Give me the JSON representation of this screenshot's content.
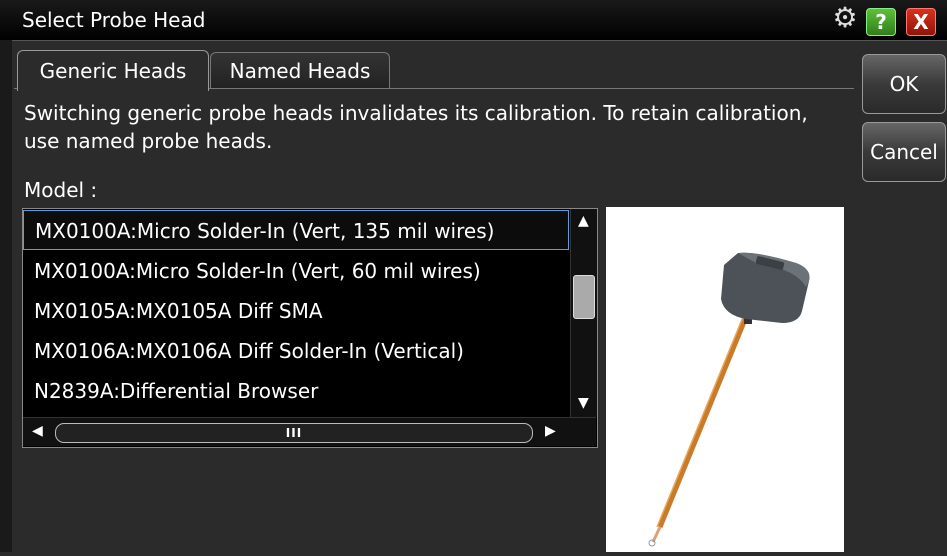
{
  "window": {
    "title": "Select Probe Head"
  },
  "titlebar": {
    "settings_icon": "gear-icon",
    "help_label": "?",
    "close_label": "X"
  },
  "tabs": [
    {
      "label": "Generic Heads",
      "selected": true
    },
    {
      "label": "Named Heads",
      "selected": false
    }
  ],
  "info_text": "Switching generic probe heads invalidates its calibration. To retain calibration, use named probe heads.",
  "model": {
    "label": "Model :",
    "items": [
      {
        "label": "MX0100A:Micro Solder-In (Vert, 135 mil wires)",
        "selected": true
      },
      {
        "label": "MX0100A:Micro Solder-In (Vert, 60 mil wires)",
        "selected": false
      },
      {
        "label": "MX0105A:MX0105A Diff SMA",
        "selected": false
      },
      {
        "label": "MX0106A:MX0106A Diff Solder-In (Vertical)",
        "selected": false
      },
      {
        "label": "N2839A:Differential Browser",
        "selected": false
      }
    ],
    "hscroll_thumb_glyph": "III"
  },
  "buttons": {
    "ok": "OK",
    "cancel": "Cancel"
  },
  "colors": {
    "selection_border": "#5aa0d8",
    "help": "#3f9f22",
    "close": "#c0200e"
  }
}
